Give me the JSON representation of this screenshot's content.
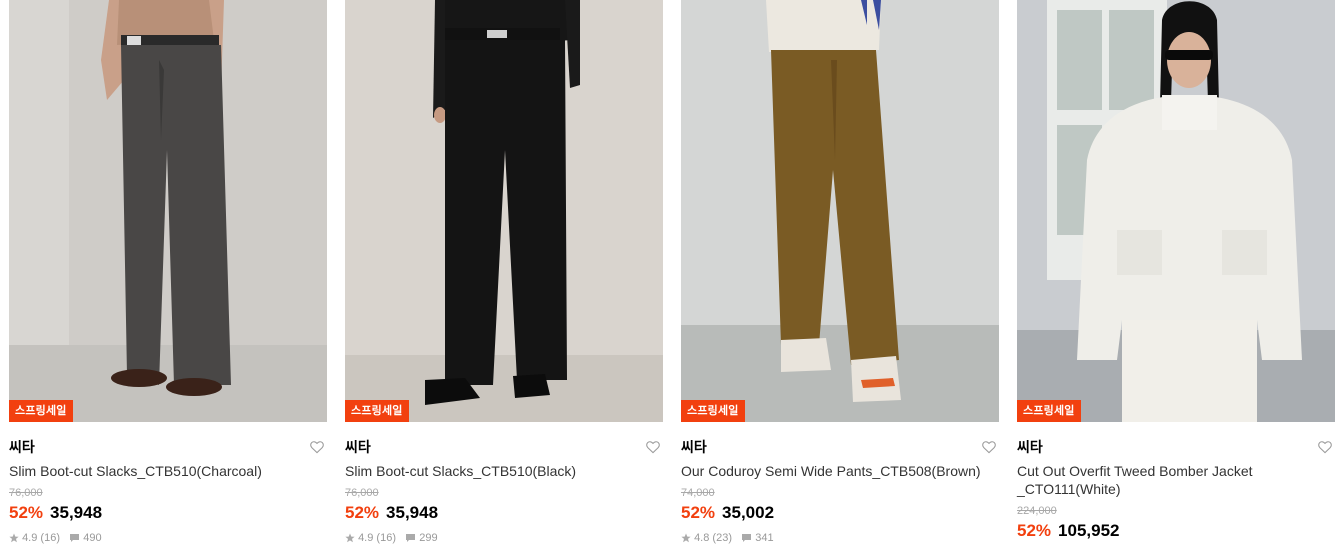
{
  "products": [
    {
      "badge": "스프링세일",
      "brand": "씨타",
      "name": "Slim Boot-cut Slacks_CTB510(Charcoal)",
      "original_price": "76,000",
      "discount": "52%",
      "price": "35,948",
      "rating": "4.9",
      "reviews": "(16)",
      "comments": "490",
      "image": "charcoal-slacks-photo",
      "liked": false
    },
    {
      "badge": "스프링세일",
      "brand": "씨타",
      "name": "Slim Boot-cut Slacks_CTB510(Black)",
      "original_price": "76,000",
      "discount": "52%",
      "price": "35,948",
      "rating": "4.9",
      "reviews": "(16)",
      "comments": "299",
      "image": "black-slacks-photo",
      "liked": false
    },
    {
      "badge": "스프링세일",
      "brand": "씨타",
      "name": "Our Coduroy Semi Wide Pants_CTB508(Brown)",
      "original_price": "74,000",
      "discount": "52%",
      "price": "35,002",
      "rating": "4.8",
      "reviews": "(23)",
      "comments": "341",
      "image": "brown-corduroy-pants-photo",
      "liked": false
    },
    {
      "badge": "스프링세일",
      "brand": "씨타",
      "name": "Cut Out Overfit Tweed Bomber Jacket _CTO111(White)",
      "original_price": "224,000",
      "discount": "52%",
      "price": "105,952",
      "rating": "",
      "reviews": "",
      "comments": "",
      "image": "white-tweed-jacket-photo",
      "liked": false
    }
  ],
  "colors": {
    "sale_accent": "#f2400f",
    "strike_price": "#a8a8a8",
    "meta_text": "#999999"
  }
}
